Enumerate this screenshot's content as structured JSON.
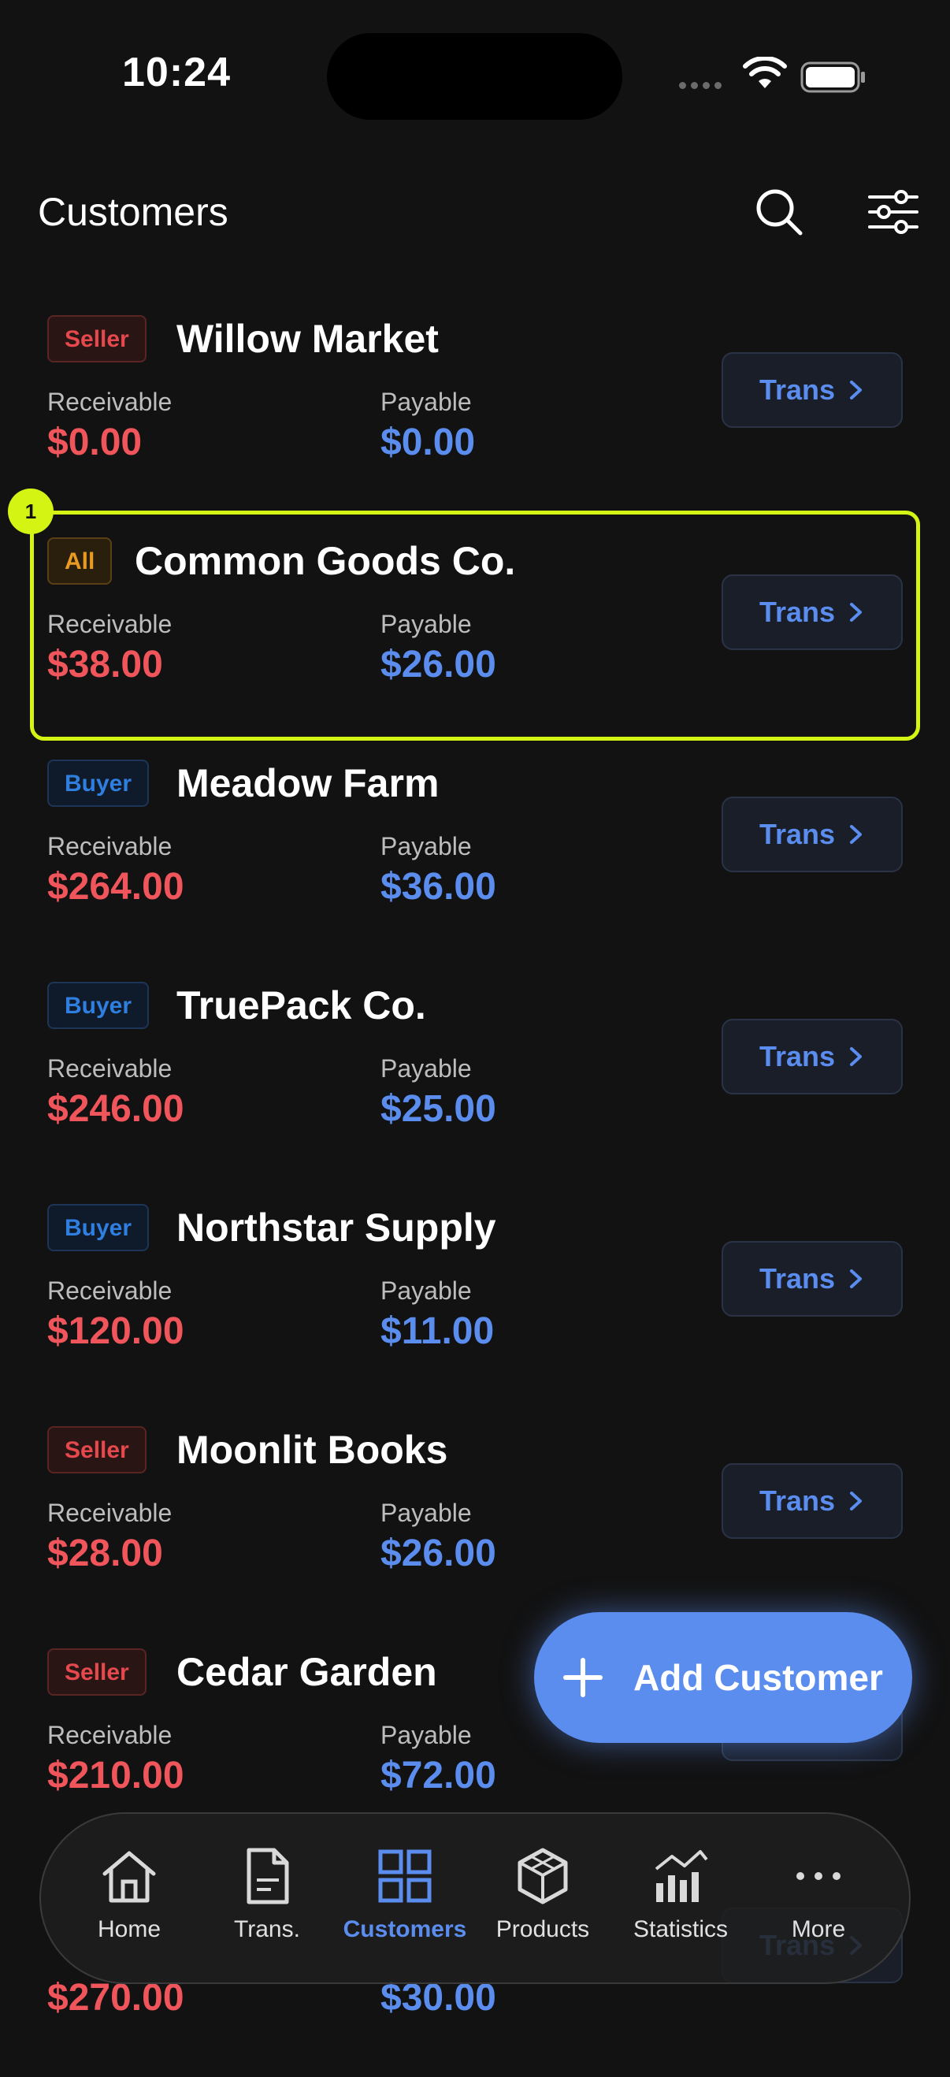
{
  "status_bar": {
    "time": "10:24"
  },
  "header": {
    "title": "Customers",
    "search_icon": "search-icon",
    "filter_icon": "sliders-icon"
  },
  "labels": {
    "receivable": "Receivable",
    "payable": "Payable",
    "trans_button": "Trans"
  },
  "customers": [
    {
      "badge": "Seller",
      "type": "seller",
      "name": "Willow Market",
      "receivable": "$0.00",
      "payable": "$0.00"
    },
    {
      "badge": "All",
      "type": "all",
      "name": "Common Goods Co.",
      "receivable": "$38.00",
      "payable": "$26.00"
    },
    {
      "badge": "Buyer",
      "type": "buyer",
      "name": "Meadow Farm",
      "receivable": "$264.00",
      "payable": "$36.00"
    },
    {
      "badge": "Buyer",
      "type": "buyer",
      "name": "TruePack Co.",
      "receivable": "$246.00",
      "payable": "$25.00"
    },
    {
      "badge": "Buyer",
      "type": "buyer",
      "name": "Northstar Supply",
      "receivable": "$120.00",
      "payable": "$11.00"
    },
    {
      "badge": "Seller",
      "type": "seller",
      "name": "Moonlit Books",
      "receivable": "$28.00",
      "payable": "$26.00"
    },
    {
      "badge": "Seller",
      "type": "seller",
      "name": "Cedar Garden",
      "receivable": "$210.00",
      "payable": "$72.00"
    },
    {
      "badge": "",
      "type": "seller",
      "name": "",
      "receivable": "$270.00",
      "payable": "$30.00"
    }
  ],
  "highlight": {
    "label": "1"
  },
  "fab": {
    "label": "Add Customer"
  },
  "nav": {
    "items": [
      {
        "label": "Home",
        "icon": "home-icon"
      },
      {
        "label": "Trans.",
        "icon": "document-icon"
      },
      {
        "label": "Customers",
        "icon": "grid-icon",
        "active": true
      },
      {
        "label": "Products",
        "icon": "cube-icon"
      },
      {
        "label": "Statistics",
        "icon": "chart-icon"
      },
      {
        "label": "More",
        "icon": "more-icon"
      }
    ]
  },
  "colors": {
    "background": "#121212",
    "accent_blue": "#5B8DEF",
    "receivable_red": "#F0555B",
    "highlight": "#D4F514"
  }
}
